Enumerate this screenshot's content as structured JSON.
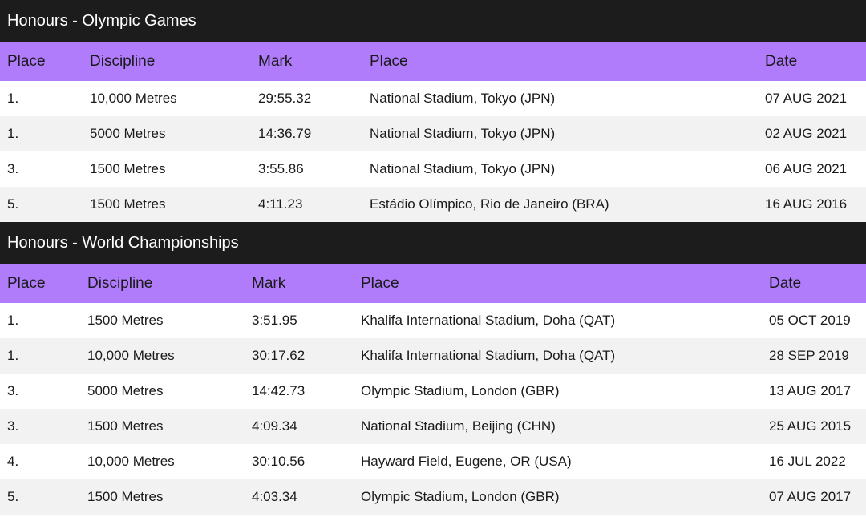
{
  "olympic": {
    "title": "Honours - Olympic Games",
    "headers": [
      "Place",
      "Discipline",
      "Mark",
      "Place",
      "Date"
    ],
    "rows": [
      [
        "1.",
        "10,000 Metres",
        "29:55.32",
        "National Stadium, Tokyo (JPN)",
        "07 AUG 2021"
      ],
      [
        "1.",
        "5000 Metres",
        "14:36.79",
        "National Stadium, Tokyo (JPN)",
        "02 AUG 2021"
      ],
      [
        "3.",
        "1500 Metres",
        "3:55.86",
        "National Stadium, Tokyo (JPN)",
        "06 AUG 2021"
      ],
      [
        "5.",
        "1500 Metres",
        "4:11.23",
        "Estádio Olímpico, Rio de Janeiro (BRA)",
        "16 AUG 2016"
      ]
    ]
  },
  "world": {
    "title": "Honours - World Championships",
    "headers": [
      "Place",
      "Discipline",
      "Mark",
      "Place",
      "Date"
    ],
    "rows": [
      [
        "1.",
        "1500 Metres",
        "3:51.95",
        "Khalifa International Stadium, Doha (QAT)",
        "05 OCT 2019"
      ],
      [
        "1.",
        "10,000 Metres",
        "30:17.62",
        "Khalifa International Stadium, Doha (QAT)",
        "28 SEP 2019"
      ],
      [
        "3.",
        "5000 Metres",
        "14:42.73",
        "Olympic Stadium, London (GBR)",
        "13 AUG 2017"
      ],
      [
        "3.",
        "1500 Metres",
        "4:09.34",
        "National Stadium, Beijing (CHN)",
        "25 AUG 2015"
      ],
      [
        "4.",
        "10,000 Metres",
        "30:10.56",
        "Hayward Field, Eugene, OR (USA)",
        "16 JUL 2022"
      ],
      [
        "5.",
        "1500 Metres",
        "4:03.34",
        "Olympic Stadium, London (GBR)",
        "07 AUG 2017"
      ]
    ]
  },
  "colors": {
    "title_bar": "#1c1c1c",
    "header_row": "#b07cfb",
    "row_alt": "#f2f2f2"
  }
}
